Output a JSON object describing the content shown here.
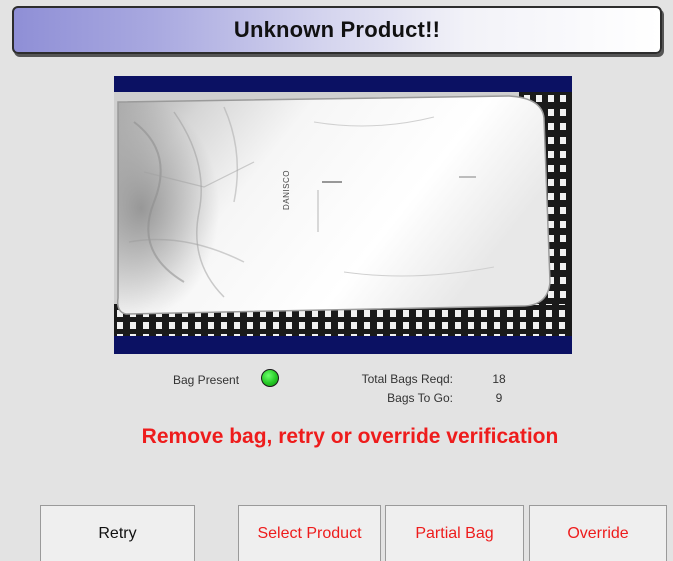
{
  "title": "Unknown Product!!",
  "camera": {
    "bag_print": "DANISCO"
  },
  "status": {
    "bag_present_label": "Bag Present",
    "bag_present_indicator_color": "#2ecc2e",
    "total_bags_label": "Total Bags Reqd:",
    "total_bags_value": "18",
    "bags_to_go_label": "Bags To Go:",
    "bags_to_go_value": "9"
  },
  "message": "Remove bag, retry or override verification",
  "buttons": {
    "retry": "Retry",
    "select_product": "Select Product",
    "partial_bag": "Partial Bag",
    "override": "Override"
  },
  "colors": {
    "alert_red": "#ee1c1c",
    "camera_border": "#0b1163",
    "title_gradient_start": "#8f8fd6"
  }
}
